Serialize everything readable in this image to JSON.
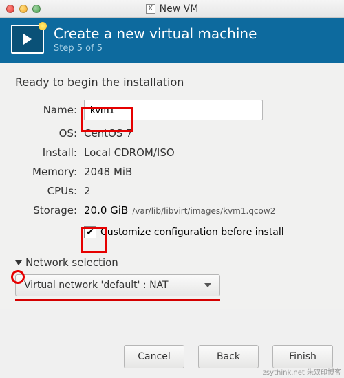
{
  "window": {
    "title": "New VM"
  },
  "header": {
    "title": "Create a new virtual machine",
    "step": "Step 5 of 5"
  },
  "body": {
    "ready": "Ready to begin the installation",
    "labels": {
      "name": "Name:",
      "os": "OS:",
      "install": "Install:",
      "memory": "Memory:",
      "cpus": "CPUs:",
      "storage": "Storage:"
    },
    "values": {
      "name": "kvm1",
      "os": "CentOS 7",
      "install": "Local CDROM/ISO",
      "memory": "2048 MiB",
      "cpus": "2",
      "storage_size": "20.0 GiB",
      "storage_path": "/var/lib/libvirt/images/kvm1.qcow2"
    },
    "customize": {
      "checked": true,
      "label": "Customize configuration before install"
    }
  },
  "network": {
    "section_title": "Network selection",
    "selected": "Virtual network 'default' : NAT"
  },
  "footer": {
    "cancel": "Cancel",
    "back": "Back",
    "finish": "Finish"
  },
  "watermark": "zsythink.net 朱双印博客"
}
